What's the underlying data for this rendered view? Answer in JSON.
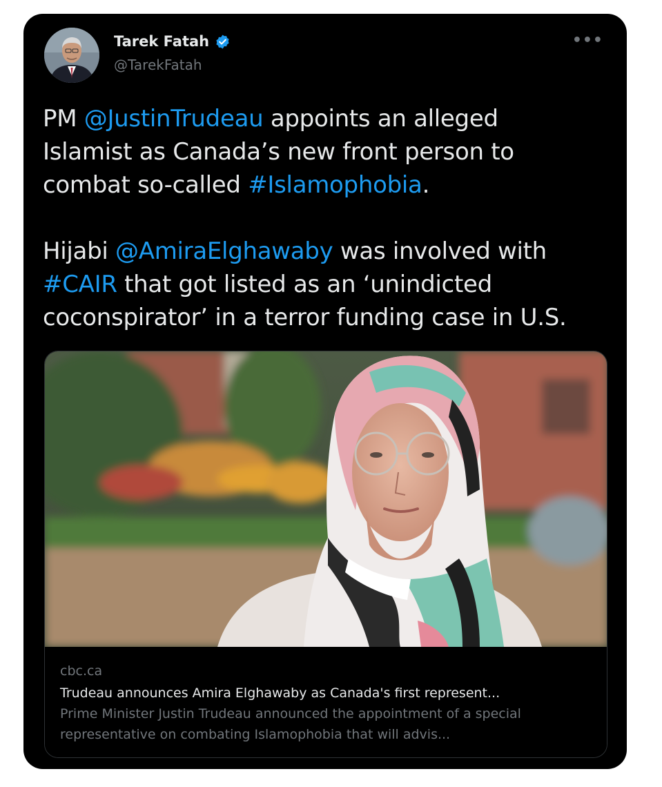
{
  "author": {
    "name": "Tarek Fatah",
    "handle": "@TarekFatah",
    "verified": true,
    "avatar_icon": "person-avatar"
  },
  "menu": {
    "more_label": "•••"
  },
  "tweet": {
    "paragraph1": [
      {
        "text": "PM ",
        "type": "text"
      },
      {
        "text": "@JustinTrudeau",
        "type": "mention"
      },
      {
        "text": " appoints an alleged",
        "type": "text"
      },
      {
        "text": "\n",
        "type": "br"
      },
      {
        "text": "Islamist as Canada’s new front person to",
        "type": "text"
      },
      {
        "text": "\n",
        "type": "br"
      },
      {
        "text": "combat so-called ",
        "type": "text"
      },
      {
        "text": "#Islamophobia",
        "type": "hashtag"
      },
      {
        "text": ".",
        "type": "text"
      }
    ],
    "paragraph2": [
      {
        "text": "Hijabi ",
        "type": "text"
      },
      {
        "text": "@AmiraElghawaby",
        "type": "mention"
      },
      {
        "text": " was involved with",
        "type": "text"
      },
      {
        "text": "\n",
        "type": "br"
      },
      {
        "text": "#CAIR",
        "type": "hashtag"
      },
      {
        "text": " that got listed as an ‘unindicted",
        "type": "text"
      },
      {
        "text": "\n",
        "type": "br"
      },
      {
        "text": "coconspirator’ in a terror funding case in U.S.",
        "type": "text"
      }
    ]
  },
  "link_card": {
    "domain": "cbc.ca",
    "title": "Trudeau announces Amira Elghawaby as Canada's first represent...",
    "description": "Prime Minister Justin Trudeau announced the appointment of a special representative on combating Islamophobia that will advis..."
  },
  "colors": {
    "background": "#000000",
    "text": "#e7e9ea",
    "muted": "#71767b",
    "link": "#1d9bf0",
    "verified": "#1d9bf0"
  }
}
